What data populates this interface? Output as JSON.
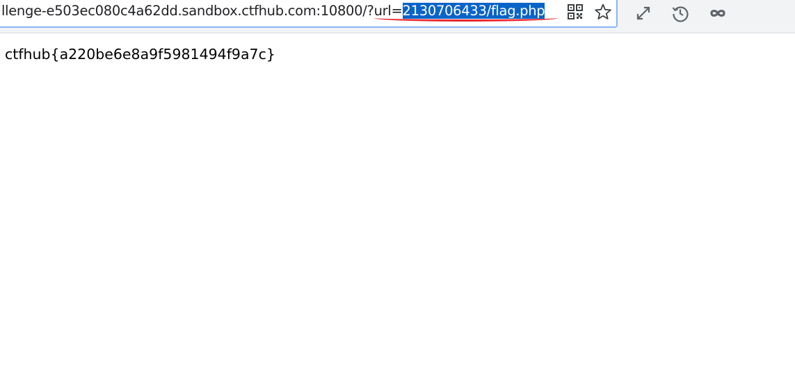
{
  "address_bar": {
    "url_prefix": "llenge-e503ec080c4a62dd.sandbox.ctfhub.com:10800/?url=",
    "url_selected": "2130706433/flag.php"
  },
  "icons": {
    "qr": "qr-code-icon",
    "bookmark": "star-icon",
    "fullscreen": "expand-icon",
    "history": "history-icon",
    "extension": "infinity-icon"
  },
  "colors": {
    "selection": "#0a64c8",
    "annotation": "#e8272a",
    "focus_border": "#8ab4f8"
  },
  "page": {
    "body_text": "ctfhub{a220be6e8a9f5981494f9a7c}"
  }
}
